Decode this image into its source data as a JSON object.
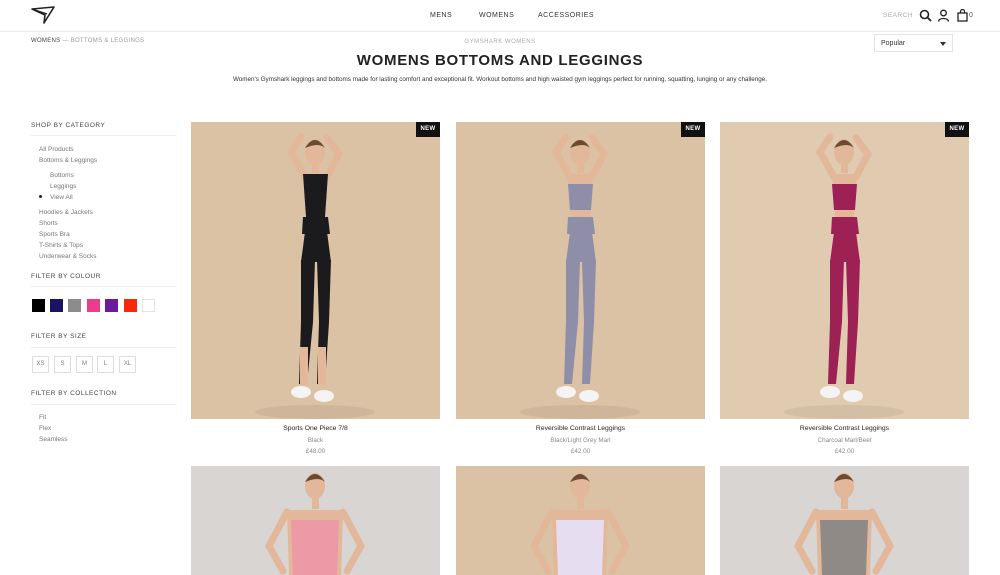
{
  "header": {
    "nav": [
      "MENS",
      "WOMENS",
      "ACCESSORIES"
    ],
    "search_label": "SEARCH",
    "cart_count": "0"
  },
  "breadcrumb": {
    "first": "WOMENS",
    "separator": "—",
    "last": "BOTTOMS & LEGGINGS"
  },
  "subheading": "GYMSHARK WOMENS",
  "sort": {
    "selected": "Popular"
  },
  "page_title": "WOMENS BOTTOMS AND LEGGINGS",
  "description": "Women's Gymshark leggings and bottoms made for lasting comfort and exceptional fit. Workout bottoms and high waisted gym leggings perfect for running, squatting, lunging or any challenge.",
  "sidebar": {
    "category_title": "SHOP BY CATEGORY",
    "categories": [
      "All Products",
      "Bottoms & Leggings",
      "Bottoms",
      "Leggings",
      "View All",
      "Hoodies & Jackets",
      "Shorts",
      "Sports Bra",
      "T-Shirts & Tops",
      "Underwear & Socks"
    ],
    "colour_title": "FILTER BY COLOUR",
    "colours": [
      "#000000",
      "#1a1363",
      "#8c8c8c",
      "#ee3b8a",
      "#6b1a9e",
      "#f62a08",
      "#ffffff"
    ],
    "size_title": "FILTER BY SIZE",
    "sizes": [
      "XS",
      "S",
      "M",
      "L",
      "XL"
    ],
    "collection_title": "FILTER BY COLLECTION",
    "collections": [
      "Fit",
      "Flex",
      "Seamless"
    ]
  },
  "products": [
    {
      "badge": "NEW",
      "name": "Sports One Piece 7/8",
      "colour": "Black",
      "price": "£48.00",
      "bg": "#dcc2a4",
      "garment": "#1b1b1d"
    },
    {
      "badge": "NEW",
      "name": "Reversible Contrast Leggings",
      "colour": "Black/Light Grey Marl",
      "price": "£42.00",
      "bg": "#dcc2a4",
      "garment": "#8e8ea8"
    },
    {
      "badge": "NEW",
      "name": "Reversible Contrast Leggings",
      "colour": "Charcoal Marl/Beet",
      "price": "£42.00",
      "bg": "#e1cbb0",
      "garment": "#9e2155"
    },
    {
      "bg": "#d8d5d3",
      "garment": "#ec9aa5"
    },
    {
      "bg": "#dcc2a4",
      "garment": "#e6def0"
    },
    {
      "bg": "#d8d5d3",
      "garment": "#8f8a86"
    }
  ]
}
